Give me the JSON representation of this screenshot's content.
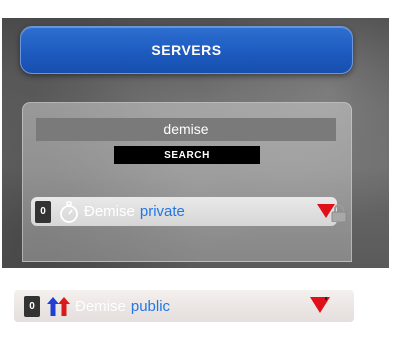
{
  "header": {
    "title": "SERVERS"
  },
  "search": {
    "value": "demise",
    "button_label": "SEARCH"
  },
  "servers": [
    {
      "count": "0",
      "name": "Đemise",
      "mode": "private",
      "icon": "stopwatch-icon",
      "locked": true
    },
    {
      "count": "0",
      "name": "Đemise",
      "mode": "public",
      "icon": "team-arrows-icon",
      "locked": false
    }
  ],
  "colors": {
    "header_blue": "#1d5bc0",
    "mode_blue": "#2277e6",
    "arrow_red": "#e0101a"
  }
}
